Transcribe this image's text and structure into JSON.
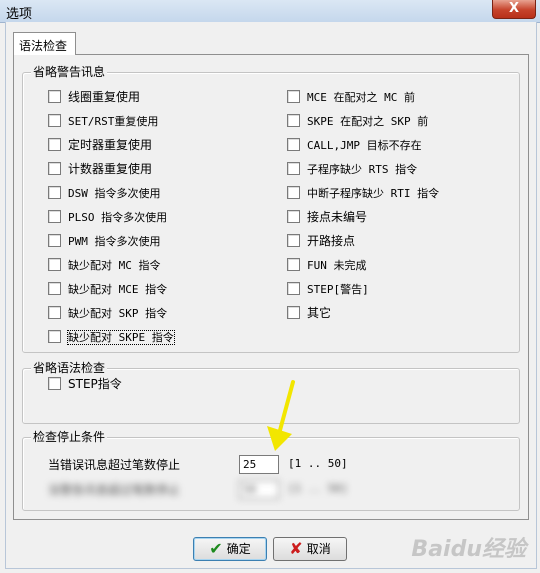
{
  "window": {
    "title": "选项",
    "close_label": "X"
  },
  "tabs": [
    {
      "label": "语法检查"
    }
  ],
  "warnings_group": {
    "legend": "省略警告讯息",
    "left": [
      "线圈重复使用",
      "SET/RST重复使用",
      "定时器重复使用",
      "计数器重复使用",
      "DSW 指令多次使用",
      "PLSO 指令多次使用",
      "PWM 指令多次使用",
      "缺少配对 MC 指令",
      "缺少配对 MCE 指令",
      "缺少配对 SKP 指令",
      "缺少配对 SKPE 指令"
    ],
    "right": [
      "MCE 在配对之 MC 前",
      "SKPE 在配对之 SKP 前",
      "CALL,JMP 目标不存在",
      "子程序缺少 RTS 指令",
      "中断子程序缺少 RTI 指令",
      "接点未编号",
      "开路接点",
      "FUN 未完成",
      "STEP[警告]",
      "其它"
    ]
  },
  "syntax_group": {
    "legend": "省略语法检查",
    "items": [
      "STEP指令"
    ]
  },
  "stop_group": {
    "legend": "检查停止条件",
    "row1": {
      "label": "当错误讯息超过笔数停止",
      "value": "25",
      "range": "[1 .. 50]"
    },
    "row2": {
      "label": "当警告讯息超过笔数停止",
      "value": "50",
      "range": "[1 .. 50]"
    }
  },
  "buttons": {
    "ok": "确定",
    "cancel": "取消"
  },
  "icons": {
    "ok": "check-icon",
    "cancel": "x-icon"
  },
  "watermark": "Baidu经验",
  "colors": {
    "ok_icon": "#1d8a1d",
    "cancel_icon": "#cc1d1d",
    "annotation_arrow": "#f2e600"
  }
}
